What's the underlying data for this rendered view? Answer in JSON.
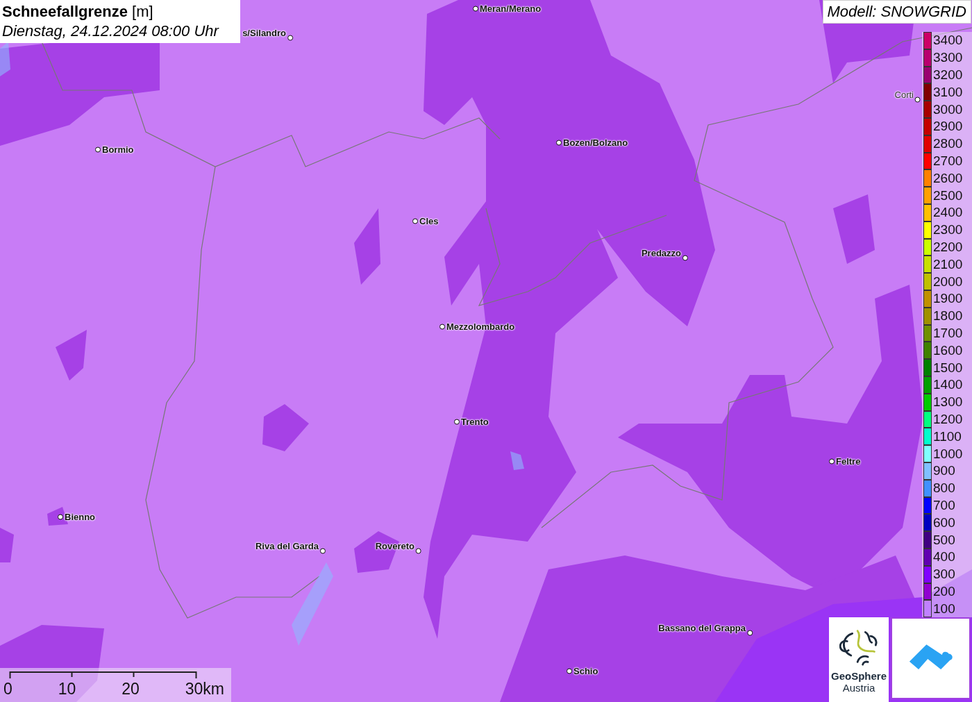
{
  "title": {
    "heading": "**Schneefallgrenze** [m]",
    "datetime": "Dienstag, 24.12.2024 08:00 Uhr"
  },
  "model_label": "Modell: SNOWGRID",
  "places": [
    {
      "name": "Meran/Merano"
    },
    {
      "name": "s/Silandro"
    },
    {
      "name": "Bormio"
    },
    {
      "name": "Bozen/Bolzano"
    },
    {
      "name": "Cles"
    },
    {
      "name": "Predazzo"
    },
    {
      "name": "Mezzolombardo"
    },
    {
      "name": "Trento"
    },
    {
      "name": "Feltre"
    },
    {
      "name": "Bienno"
    },
    {
      "name": "Riva del Garda"
    },
    {
      "name": "Rovereto"
    },
    {
      "name": "Bassano del Grappa"
    },
    {
      "name": "Schio"
    },
    {
      "name": "Corti"
    }
  ],
  "legend": [
    {
      "label": "3400",
      "color": "#cc0066"
    },
    {
      "label": "3300",
      "color": "#b8006e"
    },
    {
      "label": "3200",
      "color": "#990070"
    },
    {
      "label": "3100",
      "color": "#800000"
    },
    {
      "label": "3000",
      "color": "#a80000"
    },
    {
      "label": "2900",
      "color": "#c40000"
    },
    {
      "label": "2800",
      "color": "#e00000"
    },
    {
      "label": "2700",
      "color": "#ff0000"
    },
    {
      "label": "2600",
      "color": "#ff8000"
    },
    {
      "label": "2500",
      "color": "#ffa000"
    },
    {
      "label": "2400",
      "color": "#ffc000"
    },
    {
      "label": "2300",
      "color": "#ffff00"
    },
    {
      "label": "2200",
      "color": "#ccff00"
    },
    {
      "label": "2100",
      "color": "#c8e000"
    },
    {
      "label": "2000",
      "color": "#c0c000"
    },
    {
      "label": "1900",
      "color": "#c09000"
    },
    {
      "label": "1800",
      "color": "#a09000"
    },
    {
      "label": "1700",
      "color": "#709000"
    },
    {
      "label": "1600",
      "color": "#408000"
    },
    {
      "label": "1500",
      "color": "#008000"
    },
    {
      "label": "1400",
      "color": "#00a000"
    },
    {
      "label": "1300",
      "color": "#00cc00"
    },
    {
      "label": "1200",
      "color": "#00ff80"
    },
    {
      "label": "1100",
      "color": "#00ffcc"
    },
    {
      "label": "1000",
      "color": "#80ffff"
    },
    {
      "label": "900",
      "color": "#80c0ff"
    },
    {
      "label": "800",
      "color": "#4090ff"
    },
    {
      "label": "700",
      "color": "#0000ff"
    },
    {
      "label": "600",
      "color": "#0000c0"
    },
    {
      "label": "500",
      "color": "#400080"
    },
    {
      "label": "400",
      "color": "#6000b0"
    },
    {
      "label": "300",
      "color": "#8000ff"
    },
    {
      "label": "200",
      "color": "#9000d0"
    },
    {
      "label": "100",
      "color": "#c080ff"
    }
  ],
  "scale_bar": {
    "ticks": [
      "0",
      "10",
      "20",
      "30km"
    ]
  },
  "logos": [
    {
      "kind": "geosphere",
      "name": "GeoSphere",
      "subname": "Austria"
    },
    {
      "kind": "cloud"
    }
  ]
}
